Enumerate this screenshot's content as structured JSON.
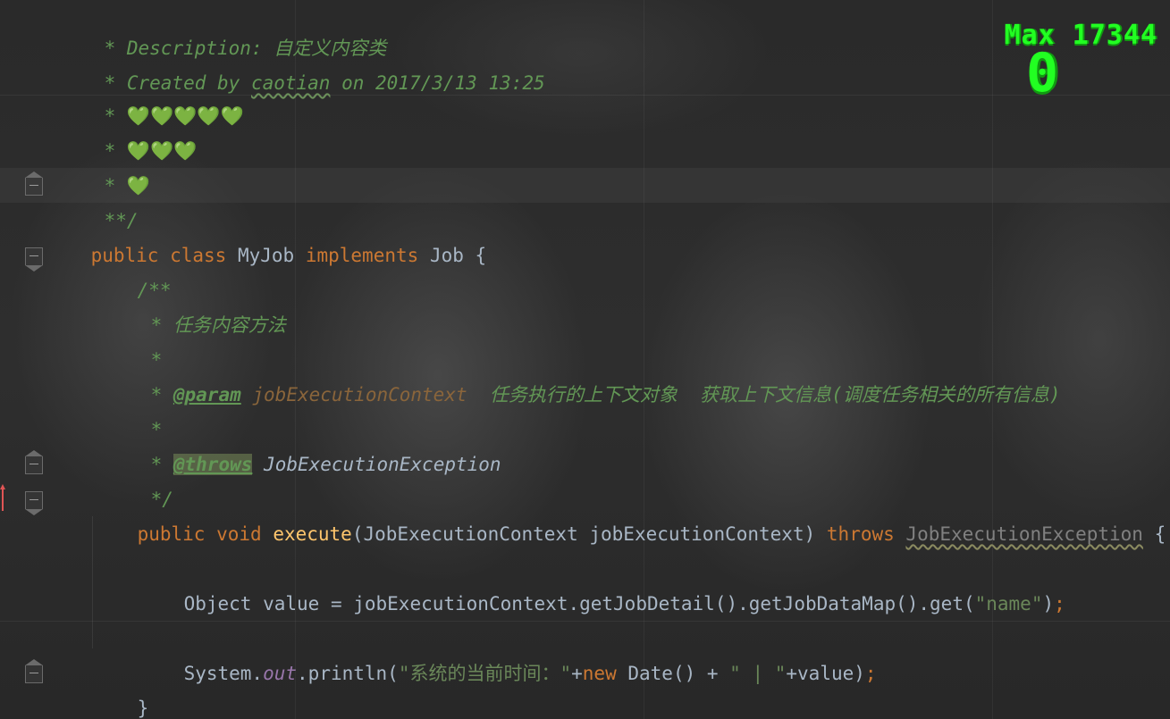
{
  "editor": {
    "lines": {
      "desc_star": "* ",
      "desc_label": "Description: ",
      "desc_value": "自定义内容类",
      "created_pre": "* Created by ",
      "created_author": "caotian",
      "created_post": " on 2017/3/13 13:25",
      "hearts5_star": "* ",
      "hearts5": "💚💚💚💚💚",
      "hearts3_star": "* ",
      "hearts3": "💚💚💚",
      "hearts1_star": "* ",
      "hearts1": "💚",
      "doc_end": "**/",
      "class_public": "public",
      "class_class": "class",
      "class_name": "MyJob",
      "class_implements": "implements",
      "class_iface": "Job",
      "class_brace": "{",
      "jd_open": "/**",
      "jd_task_star": "* ",
      "jd_task_text": "任务内容方法",
      "jd_blank1": "*",
      "jd_param_star": "* ",
      "jd_param_tag": "@param",
      "jd_param_name": "jobExecutionContext",
      "jd_param_desc": "  任务执行的上下文对象  获取上下文信息(调度任务相关的所有信息)",
      "jd_blank2": "*",
      "jd_throws_star": "* ",
      "jd_throws_tag": "@throws",
      "jd_throws_type": "JobExecutionException",
      "jd_close": "*/",
      "m_public": "public",
      "m_void": "void",
      "m_name": "execute",
      "m_paren_open": "(",
      "m_param_type": "JobExecutionContext",
      "m_param_name": "jobExecutionContext",
      "m_paren_close": ")",
      "m_throws": "throws",
      "m_exception": "JobExecutionException",
      "m_brace": "{",
      "s1_type": "Object",
      "s1_rest": "value = jobExecutionContext.getJobDetail().getJobDataMap().get(",
      "s1_str": "\"name\"",
      "s1_close": ")",
      "s1_semi": ";",
      "s2_sys": "System.",
      "s2_out": "out",
      "s2_println": ".println(",
      "s2_str1": "\"系统的当前时间：\"",
      "s2_plus1": "+",
      "s2_new": "new",
      "s2_date": "Date() + ",
      "s2_str2": "\" | \"",
      "s2_tail": "+value)",
      "s2_semi": ";",
      "m_end": "}",
      "class_end": "}"
    }
  },
  "overlay": {
    "max_label": "Max 17344",
    "count": "0"
  },
  "colors": {
    "keyword": "#cc7832",
    "method": "#ffc66d",
    "string": "#6a8759",
    "doc_comment": "#629755",
    "field": "#9876aa",
    "overlay": "#22ff22",
    "override_marker": "#e05555"
  }
}
